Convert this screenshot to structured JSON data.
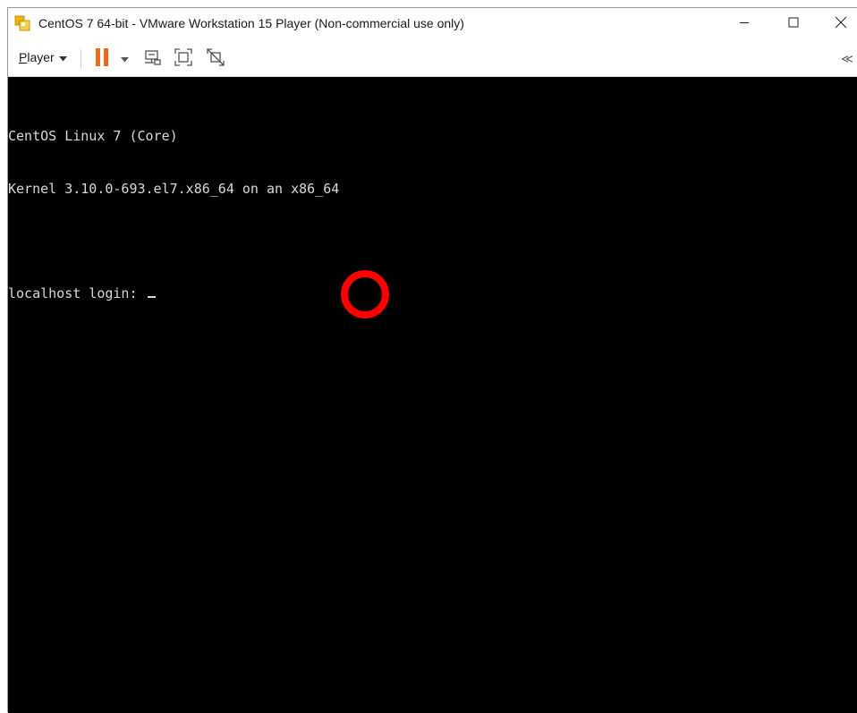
{
  "window": {
    "title": "CentOS 7 64-bit - VMware Workstation 15 Player (Non-commercial use only)",
    "icon": "vmware-icon",
    "controls": {
      "minimize": "minimize-icon",
      "maximize": "maximize-icon",
      "close": "close-icon"
    }
  },
  "toolbar": {
    "player_menu_label": "Player",
    "player_menu_hotkey": "P",
    "player_menu_rest": "layer",
    "icons": [
      "pause-icon",
      "chevron-down-icon",
      "send-ctrl-alt-del-icon",
      "fullscreen-icon",
      "unity-icon",
      "collapse-toolbar-icon"
    ],
    "collapse_label": "≪",
    "pause_color": "#ea6b1b"
  },
  "console": {
    "lines": [
      "CentOS Linux 7 (Core)",
      "Kernel 3.10.0-693.el7.x86_64 on an x86_64"
    ],
    "prompt": "localhost login: ",
    "background": "#000000",
    "text_color": "#d8d8d8"
  },
  "marker": {
    "shape": "ring",
    "color": "#ff0000"
  }
}
